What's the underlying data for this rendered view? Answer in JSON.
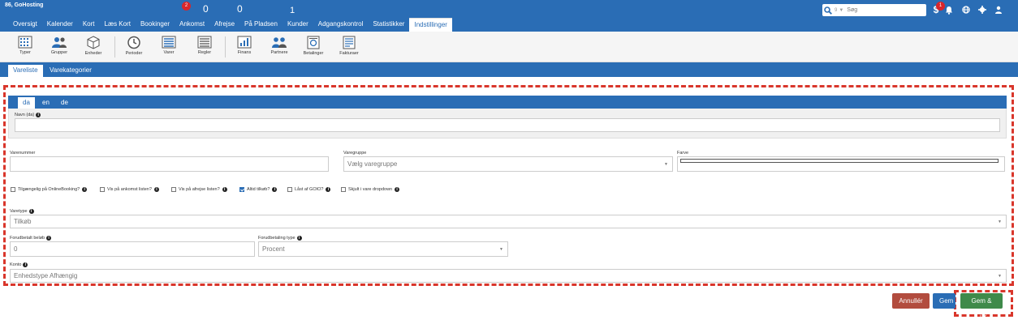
{
  "app": {
    "brand": "86, GoHosting",
    "counters": {
      "arrivals_badge": "2",
      "arrivals": "0",
      "departures": "0",
      "on_site": "1"
    }
  },
  "nav": {
    "items": [
      "Oversigt",
      "Kalender",
      "Kort",
      "Læs Kort",
      "Bookinger",
      "Ankomst",
      "Afrejse",
      "På Pladsen",
      "Kunder",
      "Adgangskontrol",
      "Statistikker",
      "Indstillinger"
    ],
    "active": "Indstillinger"
  },
  "search": {
    "count": "9",
    "placeholder": "Søg"
  },
  "notifications": {
    "badge": "1"
  },
  "toolbar": {
    "items": [
      "Typer",
      "Grupper",
      "Enheder",
      "Perioder",
      "Varer",
      "Regler",
      "Finans",
      "Partnere",
      "Betalinger",
      "Fakturaer"
    ],
    "active": "Typer"
  },
  "subtabs": {
    "items": [
      "Vareliste",
      "Varekategorier"
    ],
    "active": "Vareliste"
  },
  "languages": {
    "items": [
      "da",
      "en",
      "de"
    ],
    "active": "da"
  },
  "form": {
    "name_label": "Navn (da)",
    "name_value": "",
    "item_number_label": "Varenummer",
    "item_number_value": "",
    "group_label": "Varegruppe",
    "group_value": "Vælg varegruppe",
    "color_label": "Farve",
    "checkboxes": [
      {
        "label": "Tilgængelig på OnlineBooking?",
        "checked": false
      },
      {
        "label": "Vis på ankomst listen?",
        "checked": false
      },
      {
        "label": "Vis på afrejse listen?",
        "checked": false
      },
      {
        "label": "Altid tilkøb?",
        "checked": true
      },
      {
        "label": "Låst af GOIO?",
        "checked": false
      },
      {
        "label": "Skjult i vare dropdown",
        "checked": false
      }
    ],
    "type_label": "Varetype",
    "type_value": "Tilkøb",
    "prepaid_label": "Forudbetalt beløb",
    "prepaid_value": "0",
    "prepaid_type_label": "Forudbetaling type",
    "prepaid_type_value": "Procent",
    "account_label": "Konto",
    "account_value": "Enhedstype Afhængig"
  },
  "buttons": {
    "cancel": "Annullér",
    "save": "Gem",
    "save_close": "Gem & Luk"
  },
  "colors": {
    "primary": "#2a6db5",
    "cancel": "#b24c3e",
    "save": "#2a6db5",
    "save_close": "#3f8a4a",
    "badge": "#d9262b",
    "highlight": "#d9362b"
  }
}
